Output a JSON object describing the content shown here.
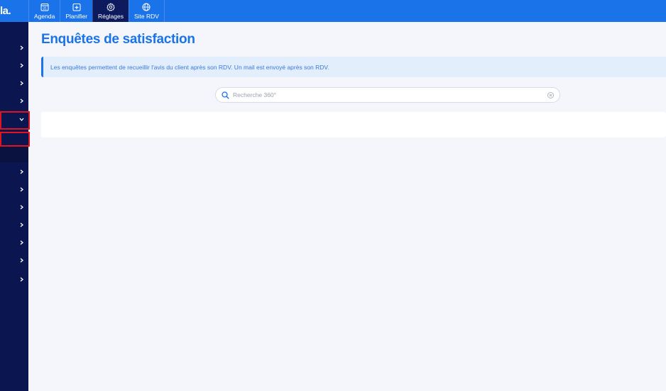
{
  "app": {
    "logo_text": "la."
  },
  "nav": [
    {
      "label": "Agenda",
      "icon": "calendar-icon",
      "active": false
    },
    {
      "label": "Planifier",
      "icon": "plus-square-icon",
      "active": false
    },
    {
      "label": "Réglages",
      "icon": "gear-icon",
      "active": true
    },
    {
      "label": "Site RDV",
      "icon": "globe-icon",
      "active": false
    }
  ],
  "nav_icon_text": {
    "calendar_day": "31"
  },
  "colors": {
    "accent": "#1a73e8",
    "sidebar": "#0b1650",
    "nav_active": "#0d1b5e",
    "highlight": "#e0141e",
    "background": "#f4f6fb"
  },
  "page": {
    "title": "Enquêtes de satisfaction",
    "info": "Les enquêtes permettent de recueillir l'avis du client après son RDV. Un mail est envoyé après son RDV."
  },
  "search": {
    "placeholder": "Recherche 360°",
    "value": ""
  }
}
